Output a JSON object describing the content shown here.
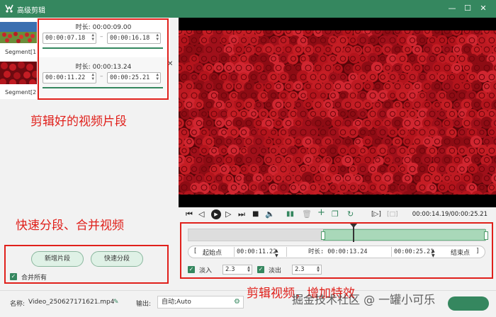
{
  "window": {
    "title": "高级剪辑",
    "controls": [
      "—",
      "☐",
      "✕"
    ]
  },
  "thumbnails": [
    {
      "label": "Segment[1]"
    },
    {
      "label": "Segment[2]"
    }
  ],
  "segments": [
    {
      "duration_label": "时长:",
      "duration": "00:00:09.00",
      "start": "00:00:07.18",
      "end": "00:00:16.18",
      "separator": "–"
    },
    {
      "duration_label": "时长:",
      "duration": "00:00:13.24",
      "start": "00:00:11.22",
      "end": "00:00:25.21",
      "separator": "–"
    }
  ],
  "annotations": {
    "clipped_segments": "剪辑好的视频片段",
    "quick_split": "快速分段、合并视频",
    "edit_effects": "剪辑视频，增加特效"
  },
  "left_panel": {
    "add_segment": "新增片段",
    "quick_split": "快速分段",
    "merge_all": "合并所有"
  },
  "player": {
    "time_readout": "00:00:14.19/00:00:25.21"
  },
  "range": {
    "start_label": "起始点",
    "start_value": "00:00:11.22",
    "duration_label": "时长:",
    "duration_value": "00:00:13.24",
    "end_value": "00:00:25.21",
    "end_label": "结束点",
    "left_bracket": "[",
    "right_bracket": "]"
  },
  "fade": {
    "fade_in_label": "淡入",
    "fade_in_value": "2.3",
    "fade_out_label": "淡出",
    "fade_out_value": "2.3"
  },
  "bottom": {
    "name_label": "名称:",
    "name_value": "Video_250627171621.mp4",
    "output_label": "输出:",
    "output_value": "自动;Auto"
  },
  "watermark": "掘金技术社区 @ 一罐小可乐",
  "colors": {
    "accent": "#35875f",
    "annotation": "#e0201b"
  }
}
